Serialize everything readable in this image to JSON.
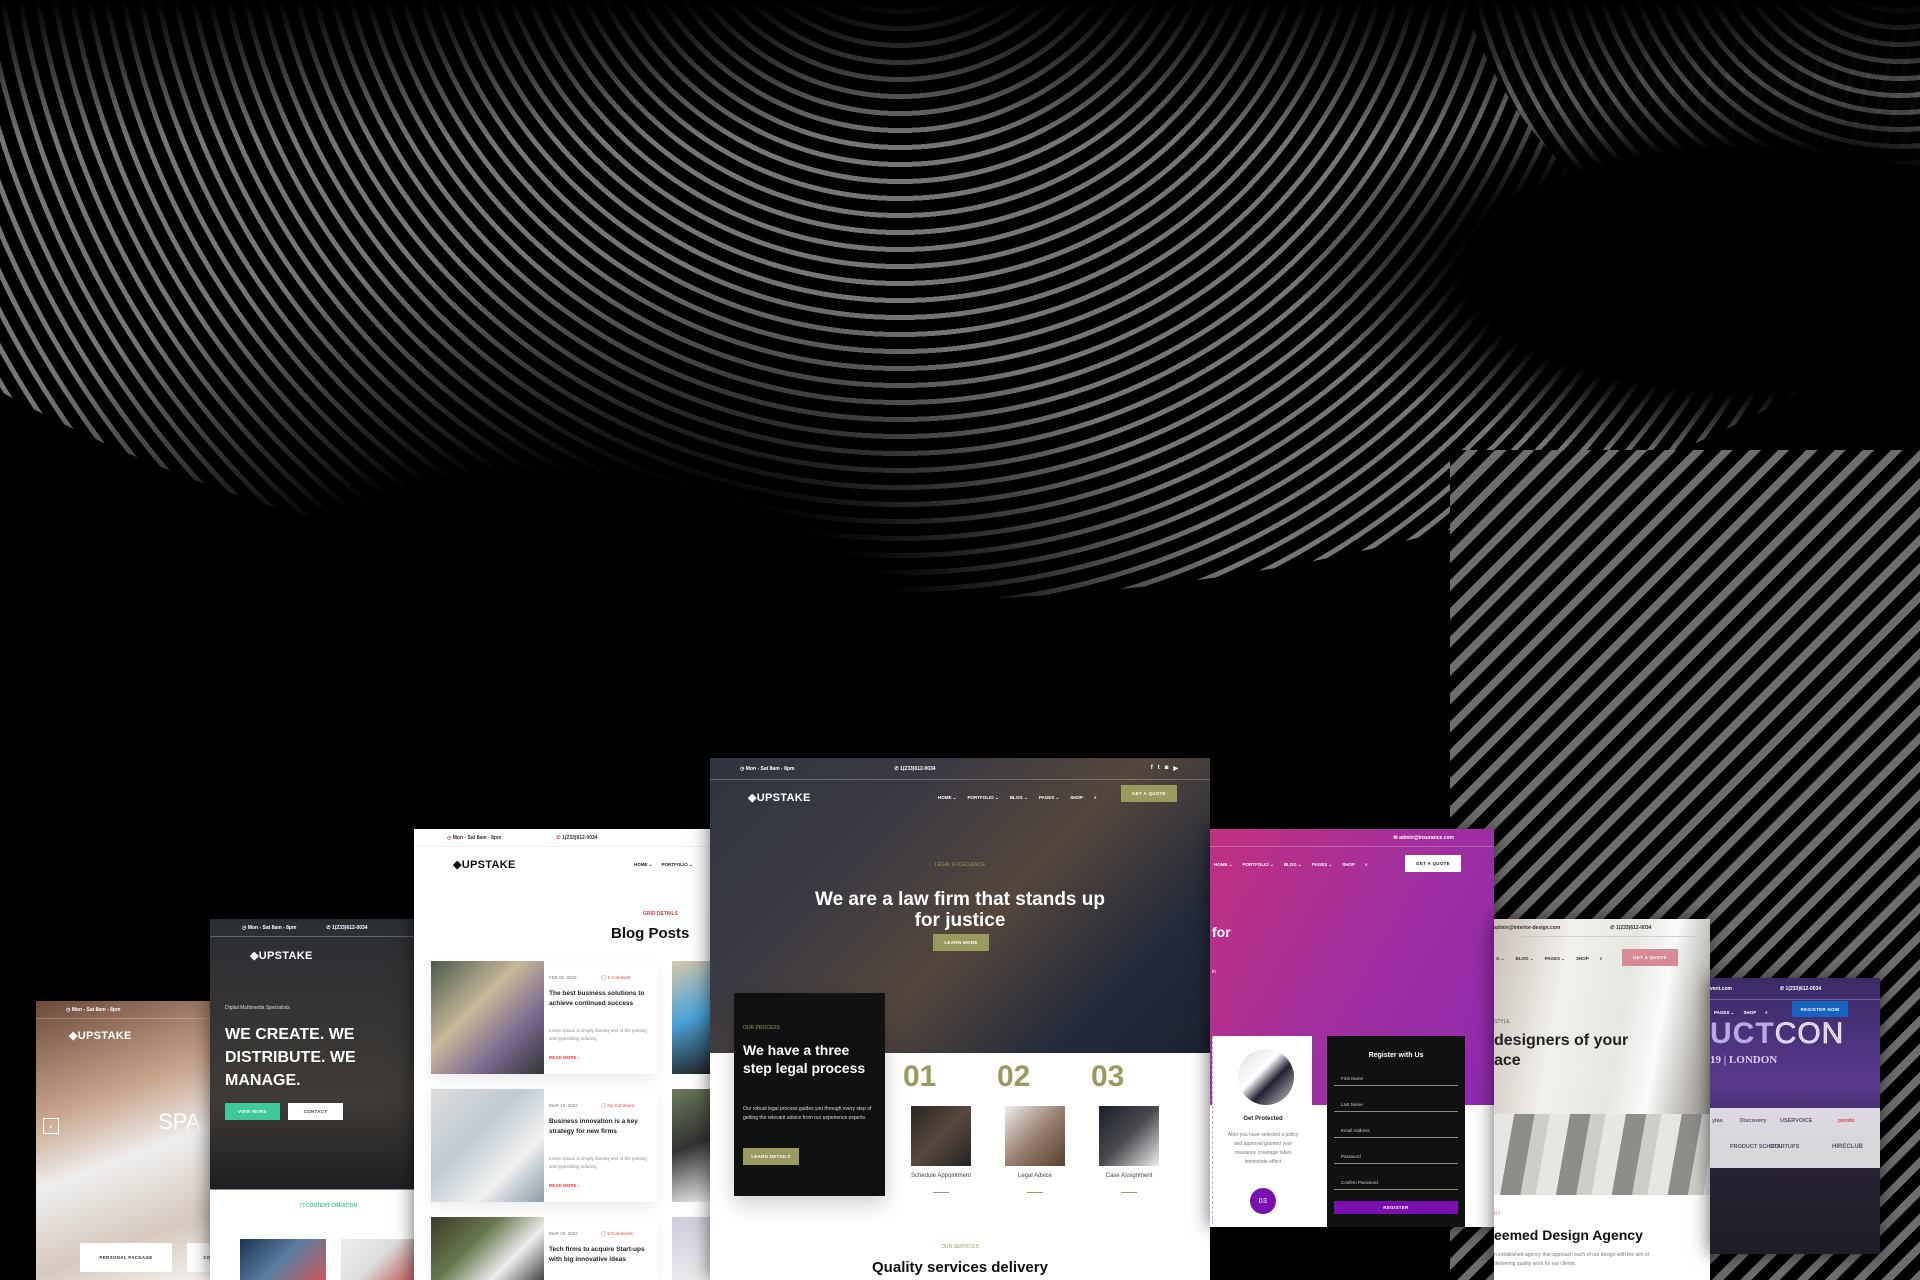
{
  "brand": "UPSTAKE",
  "hours": "Mon - Sat 8am - 8pm",
  "phone": "1(233)612-0034",
  "colors": {
    "olive": "#9a9a5f",
    "red": "#e03a3a",
    "teal": "#3ec99a",
    "purple": "#7a0fb0",
    "pink": "#d88a96",
    "blue": "#1565c0"
  },
  "spa": {
    "hero": "SPA",
    "tab1": "PERSONAL PACKAGE",
    "tab2": "CO"
  },
  "multimedia": {
    "kicker": "Digital Multimedia Specialists",
    "heading": "WE CREATE. WE DISTRIBUTE. WE MANAGE.",
    "view_more": "VIEW MORE",
    "contact": "CONTACT",
    "service": "CONTENT CREATION"
  },
  "blog": {
    "nav": [
      "HOME ⌄",
      "PORTFOLIO ⌄"
    ],
    "kicker": "GRID DETAILS",
    "title": "Blog Posts",
    "excerpt": "Lorem Ipsum is simply dummy text of the printing and typesetting industry.",
    "read_more": "READ MORE ›",
    "posts": [
      {
        "date": "FEB 05, 2023",
        "comments": "1 Comment",
        "title": "The best business solutions to achieve continued success"
      },
      {
        "date": "MAR 10, 2023",
        "comments": "No Comment",
        "title": "Business innovation is a key strategy for new firms"
      },
      {
        "date": "MAR 20, 2023",
        "comments": "5 Comments",
        "title": "Tech firms to acquire Start-ups with big innovative ideas"
      }
    ]
  },
  "law": {
    "nav": [
      "HOME ⌄",
      "PORTFOLIO ⌄",
      "BLOG ⌄",
      "PAGES ⌄",
      "SHOP"
    ],
    "quote": "GET A QUOTE",
    "kicker": "LEGAL EXCELLENCE",
    "headline": "We are a law firm that stands up for justice",
    "learn_more": "LEARN MORE",
    "process_kicker": "OUR PROCESS",
    "process_title": "We have a three step legal process",
    "process_text": "Our robust legal process guides you through every step of getting the relevant advice from our experience experts.",
    "learn_details": "LEARN DETAILS",
    "steps": [
      {
        "num": "01",
        "label": "Schedule Appointment"
      },
      {
        "num": "02",
        "label": "Legal Advice"
      },
      {
        "num": "03",
        "label": "Case Assignment"
      }
    ],
    "services_kicker": "OUR SERVICES",
    "services_title": "Quality services delivery"
  },
  "insurance": {
    "email": "admin@insurance.com",
    "nav": [
      "HOME ⌄",
      "PORTFOLIO ⌄",
      "BLOG ⌄",
      "PAGES ⌄",
      "SHOP"
    ],
    "quote": "GET A QUOTE",
    "hero_fragment": "for",
    "hero_sub": "in",
    "card_title": "Get Protected",
    "card_text": "After you have selected a policy and approval granted your insurance coverage takes immediate effect",
    "card_num": "03",
    "form_title": "Register with Us",
    "fields": [
      "First Name",
      "Last Name",
      "Email Address",
      "Password",
      "Confirm Password"
    ],
    "register": "REGISTER"
  },
  "interior": {
    "email": "admin@interior-design.com",
    "nav": [
      "O ⌄",
      "BLOG ⌄",
      "PAGES ⌄",
      "SHOP"
    ],
    "quote": "GET A QUOTE",
    "kicker": "STYLE",
    "headline1": "designers of your",
    "headline2": "ace",
    "sub_kicker": "RY",
    "title": "eemed Design Agency",
    "text": "n established agency that approach each of our design with the aim of delivering quality work for our clients."
  },
  "event": {
    "email": "vent.com",
    "nav": [
      "PAGES ⌄",
      "SHOP"
    ],
    "register": "REGISTER NOW",
    "logo_solid": "UCT",
    "logo_outline": "CON",
    "date": "19 | LONDON",
    "sponsors": [
      "ylas",
      "Discovery",
      "USERVOICE",
      "pendo",
      "PRODUCT SCHOOL",
      "STARTUPS",
      "HIRECLUB"
    ]
  }
}
